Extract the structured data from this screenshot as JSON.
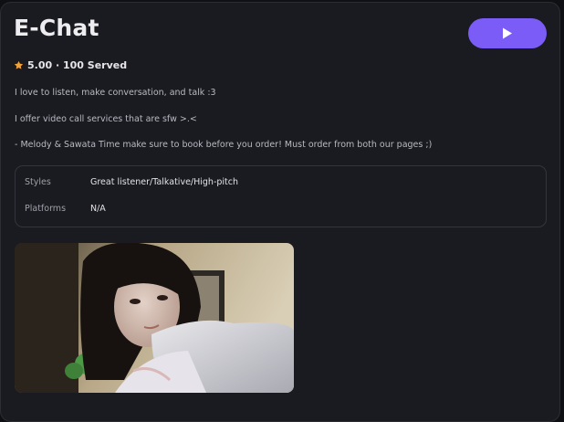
{
  "profile": {
    "name": "E-Chat",
    "rating": "5.00 · 100 Served",
    "description": [
      "I love to listen, make conversation, and talk :3",
      "I offer video call services that are sfw >.<",
      "- Melody & Sawata Time make sure to book before you order! Must order from both our pages ;)"
    ]
  },
  "details": {
    "styles_label": "Styles",
    "styles_value": "Great listener/Talkative/High-pitch",
    "platforms_label": "Platforms",
    "platforms_value": "N/A"
  },
  "icons": {
    "play": "play-icon",
    "rating": "star-icon"
  },
  "colors": {
    "accent": "#7b5cf6",
    "star": "#f0a23a",
    "card_bg": "#1a1b20"
  }
}
